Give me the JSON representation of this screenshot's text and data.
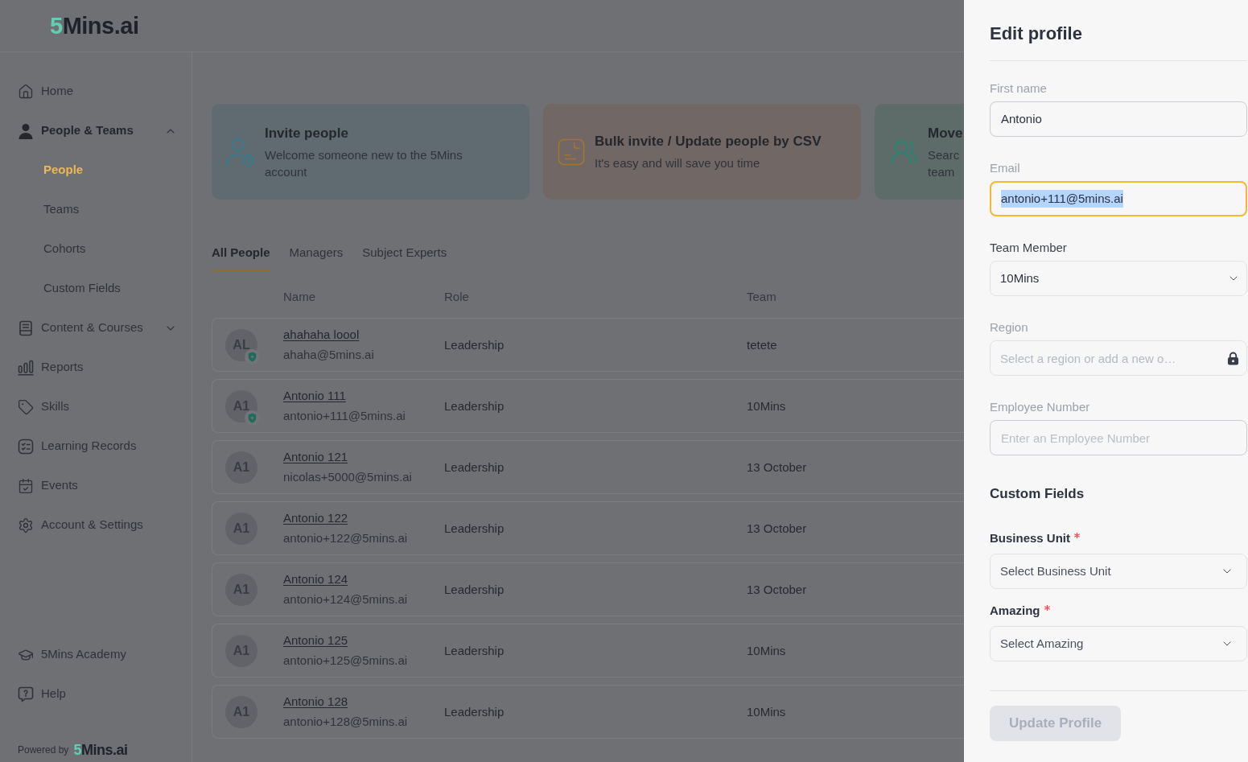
{
  "header": {
    "logo": "5Mins.ai"
  },
  "sidebar": {
    "items": [
      {
        "label": "Home",
        "selected": false
      },
      {
        "label": "People & Teams",
        "selected": true,
        "expanded": true,
        "children": [
          {
            "label": "People",
            "selected": true
          },
          {
            "label": "Teams",
            "selected": false
          },
          {
            "label": "Cohorts",
            "selected": false
          },
          {
            "label": "Custom Fields",
            "selected": false
          }
        ]
      },
      {
        "label": "Content & Courses",
        "selected": false,
        "expanded": false
      },
      {
        "label": "Reports",
        "selected": false
      },
      {
        "label": "Skills",
        "selected": false
      },
      {
        "label": "Learning Records",
        "selected": false
      },
      {
        "label": "Events",
        "selected": false
      },
      {
        "label": "Account & Settings",
        "selected": false
      }
    ],
    "footer_items": [
      {
        "label": "5Mins Academy",
        "selected": false
      },
      {
        "label": "Help",
        "selected": false
      }
    ],
    "powered_by": {
      "text": "Powered by",
      "logo": "5Mins.ai"
    }
  },
  "action_cards": [
    {
      "title": "Invite people",
      "description": "Welcome someone new to the 5Mins account"
    },
    {
      "title": "Bulk invite / Update people by CSV",
      "description": "It's easy and will save you time"
    },
    {
      "title": "Move",
      "description": "Searc team"
    }
  ],
  "tabs": [
    {
      "label": "All People",
      "selected": true
    },
    {
      "label": "Managers",
      "selected": false
    },
    {
      "label": "Subject Experts",
      "selected": false
    }
  ],
  "table": {
    "columns": [
      "Name",
      "Role",
      "Team"
    ],
    "rows": [
      {
        "initials": "AL",
        "name": "ahahaha loool",
        "email": "ahaha@5mins.ai",
        "role": "Leadership",
        "team": "tetete",
        "admin": true
      },
      {
        "initials": "A1",
        "name": "Antonio 111",
        "email": "antonio+111@5mins.ai",
        "role": "Leadership",
        "team": "10Mins",
        "admin": true
      },
      {
        "initials": "A1",
        "name": "Antonio 121",
        "email": "nicolas+5000@5mins.ai",
        "role": "Leadership",
        "team": "13 October",
        "admin": false
      },
      {
        "initials": "A1",
        "name": "Antonio 122",
        "email": "antonio+122@5mins.ai",
        "role": "Leadership",
        "team": "13 October",
        "admin": false
      },
      {
        "initials": "A1",
        "name": "Antonio 124",
        "email": "antonio+124@5mins.ai",
        "role": "Leadership",
        "team": "13 October",
        "admin": false
      },
      {
        "initials": "A1",
        "name": "Antonio 125",
        "email": "antonio+125@5mins.ai",
        "role": "Leadership",
        "team": "10Mins",
        "admin": false
      },
      {
        "initials": "A1",
        "name": "Antonio 128",
        "email": "antonio+128@5mins.ai",
        "role": "Leadership",
        "team": "10Mins",
        "admin": false
      }
    ]
  },
  "edit_profile": {
    "title": "Edit profile",
    "fields": [
      {
        "label": "First name",
        "kind": "text",
        "value": "Antonio",
        "focused": false,
        "text_selected": false
      },
      {
        "label": "Email",
        "kind": "text",
        "value": "antonio+111@5mins.ai",
        "focused": true,
        "text_selected": true
      },
      {
        "label": "Team Member",
        "kind": "select",
        "value": "10Mins",
        "focused": false,
        "text_selected": false
      },
      {
        "label": "Region",
        "kind": "locked",
        "placeholder": "Select a region or add a new o…",
        "focused": false
      },
      {
        "label": "Employee Number",
        "kind": "text",
        "placeholder": "Enter an Employee Number",
        "focused": false
      }
    ],
    "custom_fields": {
      "title": "Custom Fields",
      "fields": [
        {
          "label": "Business Unit",
          "required": true,
          "placeholder": "Select Business Unit"
        },
        {
          "label": "Amazing",
          "required": true,
          "placeholder": "Select Amazing"
        }
      ]
    },
    "submit": {
      "label": "Update Profile",
      "disabled": true
    }
  }
}
